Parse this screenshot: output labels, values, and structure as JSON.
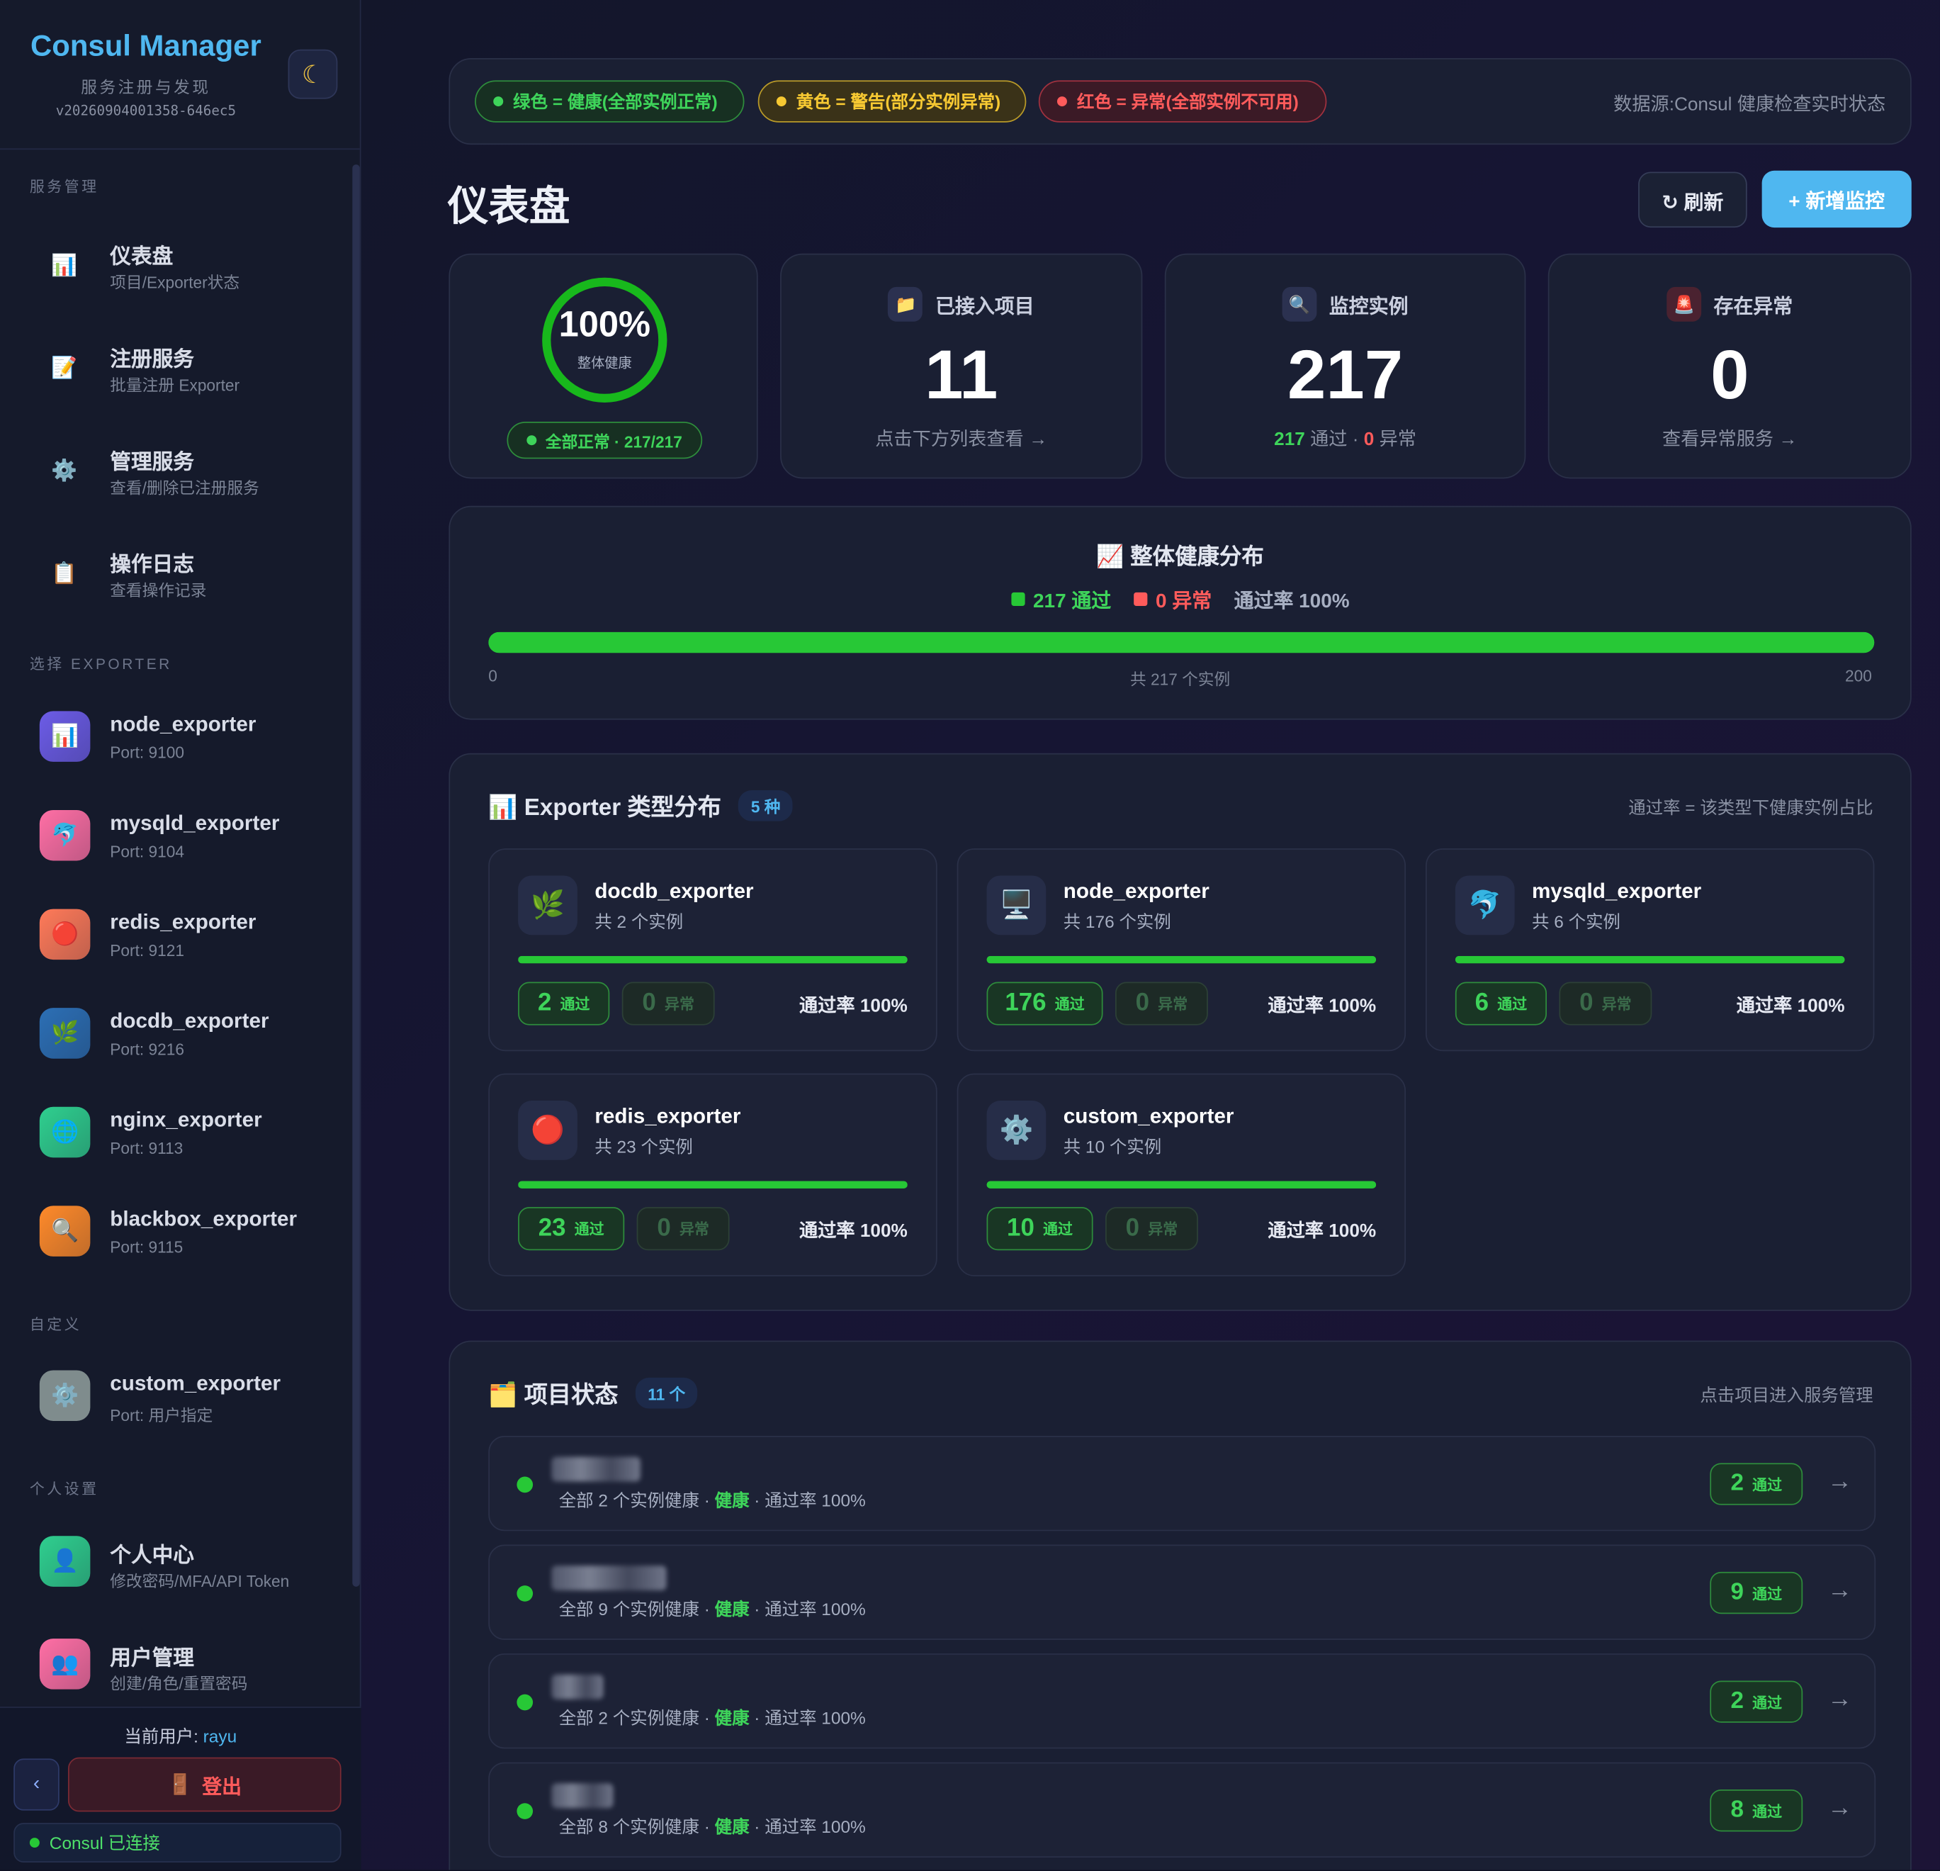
{
  "sidebar": {
    "brand": "Consul Manager",
    "subtitle": "服务注册与发现",
    "version": "v20260904001358-646ec5",
    "theme_icon": "moon-icon",
    "section_manage": "服务管理",
    "nav": [
      {
        "icon": "chart-icon",
        "glyph": "📊",
        "title": "仪表盘",
        "sub": "项目/Exporter状态"
      },
      {
        "icon": "memo-icon",
        "glyph": "📝",
        "title": "注册服务",
        "sub": "批量注册 Exporter"
      },
      {
        "icon": "gear-icon",
        "glyph": "⚙️",
        "title": "管理服务",
        "sub": "查看/删除已注册服务"
      },
      {
        "icon": "clipboard-icon",
        "glyph": "📋",
        "title": "操作日志",
        "sub": "查看操作记录"
      }
    ],
    "section_exporter": "选择 EXPORTER",
    "exporters": [
      {
        "icon": "chart-icon",
        "glyph": "📊",
        "name": "node_exporter",
        "port": "Port: 9100",
        "color": "#6c5ce7"
      },
      {
        "icon": "dolphin-icon",
        "glyph": "🐬",
        "name": "mysqld_exporter",
        "port": "Port: 9104",
        "color": "#ff6fa5"
      },
      {
        "icon": "red-circle-icon",
        "glyph": "🔴",
        "name": "redis_exporter",
        "port": "Port: 9121",
        "color": "#ff7a59"
      },
      {
        "icon": "leaf-icon",
        "glyph": "🌿",
        "name": "docdb_exporter",
        "port": "Port: 9216",
        "color": "#2c6fb5"
      },
      {
        "icon": "globe-icon",
        "glyph": "🌐",
        "name": "nginx_exporter",
        "port": "Port: 9113",
        "color": "#2fcf8f"
      },
      {
        "icon": "magnifier-icon",
        "glyph": "🔍",
        "name": "blackbox_exporter",
        "port": "Port: 9115",
        "color": "#ff8a2a"
      }
    ],
    "section_custom": "自定义",
    "custom": {
      "icon": "gear-icon",
      "glyph": "⚙️",
      "name": "custom_exporter",
      "port": "Port: 用户指定",
      "color": "#7f8c8d"
    },
    "section_personal": "个人设置",
    "personal": [
      {
        "icon": "user-icon",
        "glyph": "👤",
        "title": "个人中心",
        "sub": "修改密码/MFA/API Token",
        "color": "#2fcf8f"
      },
      {
        "icon": "users-icon",
        "glyph": "👥",
        "title": "用户管理",
        "sub": "创建/角色/重置密码",
        "color": "#ff6fa5"
      }
    ],
    "current_user_label": "当前用户: ",
    "current_user": "rayu",
    "collapse_glyph": "‹",
    "logout_glyph": "🚪",
    "logout": "登出",
    "consul_status": "Consul 已连接"
  },
  "legend": {
    "green": "绿色 = 健康(全部实例正常)",
    "yellow": "黄色 = 警告(部分实例异常)",
    "red": "红色 = 异常(全部实例不可用)",
    "source": "数据源:Consul 健康检查实时状态"
  },
  "header": {
    "title": "仪表盘",
    "refresh": "↻ 刷新",
    "add": "+ 新增监控"
  },
  "health": {
    "percent": "100%",
    "percent_value": 1.0,
    "label": "整体健康",
    "badge": "全部正常 · 217/217"
  },
  "stats": [
    {
      "icon": "folder-icon",
      "glyph": "📁",
      "title": "已接入项目",
      "value": "11",
      "foot": "点击下方列表查看 →"
    },
    {
      "icon": "magnifier-icon",
      "glyph": "🔍",
      "title": "监控实例",
      "value": "217",
      "pass": "217",
      "pass_label": "通过 · ",
      "fail": "0",
      "fail_label": "异常"
    },
    {
      "icon": "siren-icon",
      "glyph": "🚨",
      "title": "存在异常",
      "value": "0",
      "foot": "查看异常服务 →"
    }
  ],
  "distribution": {
    "title": "📈 整体健康分布",
    "pass": "217 通过",
    "fail": "0 异常",
    "rate": "通过率 100%",
    "fill": 1.0,
    "axis_left": "0",
    "axis_mid": "共 217 个实例",
    "axis_right": "200"
  },
  "exporter_section": {
    "title": "📊 Exporter 类型分布",
    "tag": "5 种",
    "note": "通过率 = 该类型下健康实例占比",
    "cards": [
      {
        "icon": "leaf-icon",
        "glyph": "🌿",
        "name": "docdb_exporter",
        "count": "共 2 个实例",
        "pass": "2",
        "fail": "0",
        "rate": "通过率 100%",
        "fill": 1.0
      },
      {
        "icon": "monitor-icon",
        "glyph": "🖥️",
        "name": "node_exporter",
        "count": "共 176 个实例",
        "pass": "176",
        "fail": "0",
        "rate": "通过率 100%",
        "fill": 1.0
      },
      {
        "icon": "dolphin-icon",
        "glyph": "🐬",
        "name": "mysqld_exporter",
        "count": "共 6 个实例",
        "pass": "6",
        "fail": "0",
        "rate": "通过率 100%",
        "fill": 1.0
      },
      {
        "icon": "red-circle-icon",
        "glyph": "🔴",
        "name": "redis_exporter",
        "count": "共 23 个实例",
        "pass": "23",
        "fail": "0",
        "rate": "通过率 100%",
        "fill": 1.0
      },
      {
        "icon": "gear-icon",
        "glyph": "⚙️",
        "name": "custom_exporter",
        "count": "共 10 个实例",
        "pass": "10",
        "fail": "0",
        "rate": "通过率 100%",
        "fill": 1.0
      }
    ],
    "pass_label": "通过",
    "fail_label": "异常"
  },
  "projects": {
    "title": "🗂️ 项目状态",
    "tag": "11 个",
    "note": "点击项目进入服务管理",
    "pass_label": "通过",
    "rows": [
      {
        "desc_pre": "全部 2 个实例健康 · ",
        "status": "健康",
        "desc_post": " · 通过率 100%",
        "pass": "2"
      },
      {
        "desc_pre": "全部 9 个实例健康 · ",
        "status": "健康",
        "desc_post": " · 通过率 100%",
        "pass": "9"
      },
      {
        "desc_pre": "全部 2 个实例健康 · ",
        "status": "健康",
        "desc_post": " · 通过率 100%",
        "pass": "2"
      },
      {
        "desc_pre": "全部 8 个实例健康 · ",
        "status": "健康",
        "desc_post": " · 通过率 100%",
        "pass": "8"
      }
    ]
  },
  "colors": {
    "accent": "#4fb7f0",
    "ok": "#27c836",
    "warn": "#f6c832",
    "err": "#ff5b5b"
  }
}
